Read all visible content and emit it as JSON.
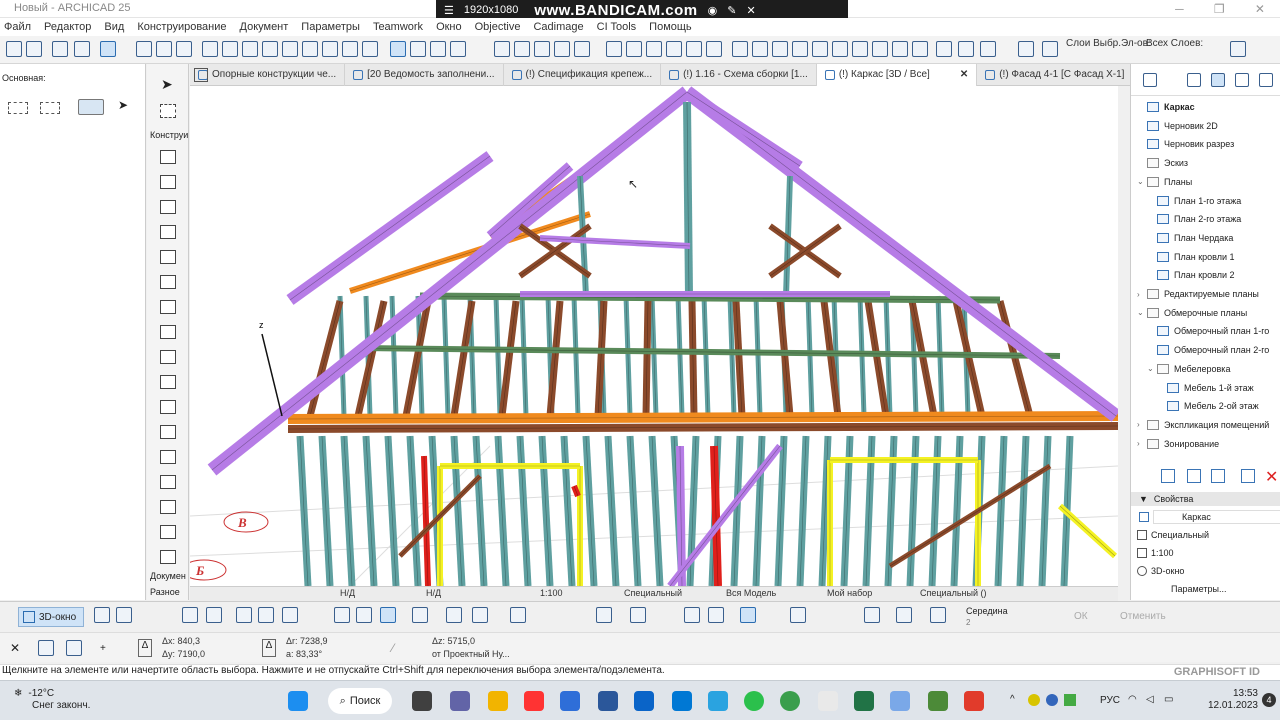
{
  "app": {
    "title": "Новый - ARCHICAD 25"
  },
  "recorder": {
    "resolution": "1920x1080",
    "brand": "www.BANDICAM.com"
  },
  "menu": [
    "Файл",
    "Редактор",
    "Вид",
    "Конструирование",
    "Документ",
    "Параметры",
    "Teamwork",
    "Окно",
    "Objective",
    "Cadimage",
    "CI Tools",
    "Помощь"
  ],
  "toolbar": {
    "layers_label": "Слои Выбр.Эл-ов:",
    "all_layers_label": "Всех Слоев:"
  },
  "leftpanel": {
    "label": "Основная:"
  },
  "toolbox": {
    "select_label": "Конструи",
    "document_label": "Докумен",
    "misc_label": "Разное"
  },
  "tabs": [
    {
      "label": "Опорные конструкции че..."
    },
    {
      "label": "[20 Ведомость заполнени..."
    },
    {
      "label": "(!) Спецификация крепеж..."
    },
    {
      "label": "(!) 1.16 - Схема сборки [1..."
    },
    {
      "label": "(!) Каркас [3D / Все]"
    },
    {
      "label": "(!) Фасад 4-1 [С Фасад Х-1]"
    }
  ],
  "viewport": {
    "axis_z": "z",
    "marker_b": "В",
    "marker_b2": "Б"
  },
  "viewbar": {
    "nd1": "Н/Д",
    "nd2": "Н/Д",
    "scale": "1:100",
    "special": "Специальный",
    "model": "Вся Модель",
    "set": "Мой набор",
    "special2": "Специальный ()"
  },
  "navigator": {
    "items": [
      {
        "label": "Каркас",
        "kind": "view",
        "level": 0,
        "bold": true
      },
      {
        "label": "Черновик 2D",
        "kind": "view",
        "level": 0
      },
      {
        "label": "Черновик разрез",
        "kind": "view",
        "level": 0
      },
      {
        "label": "Эскиз",
        "kind": "folder",
        "level": 0
      },
      {
        "label": "Планы",
        "kind": "folder",
        "level": 0,
        "arrow": "v"
      },
      {
        "label": "План 1-го этажа",
        "kind": "view",
        "level": 1
      },
      {
        "label": "План 2-го этажа",
        "kind": "view",
        "level": 1
      },
      {
        "label": "План Чердака",
        "kind": "view",
        "level": 1
      },
      {
        "label": "План кровли 1",
        "kind": "view",
        "level": 1
      },
      {
        "label": "План кровли 2",
        "kind": "view",
        "level": 1
      },
      {
        "label": "Редактируемые планы",
        "kind": "folder",
        "level": 0,
        "arrow": ">"
      },
      {
        "label": "Обмерочные планы",
        "kind": "folder",
        "level": 0,
        "arrow": "v"
      },
      {
        "label": "Обмерочный план 1-го",
        "kind": "view",
        "level": 1
      },
      {
        "label": "Обмерочный план 2-го",
        "kind": "view",
        "level": 1
      },
      {
        "label": "Мебелеровка",
        "kind": "folder",
        "level": 1,
        "arrow": "v"
      },
      {
        "label": "Мебель 1-й этаж",
        "kind": "view",
        "level": 2
      },
      {
        "label": "Мебель 2-ой этаж",
        "kind": "view",
        "level": 2
      },
      {
        "label": "Экспликация помещений",
        "kind": "folder",
        "level": 0,
        "arrow": ">"
      },
      {
        "label": "Зонирование",
        "kind": "folder",
        "level": 0,
        "arrow": ">"
      }
    ]
  },
  "properties": {
    "header": "Свойства",
    "name_value": "Каркас",
    "layer": "Специальный",
    "scale": "1:100",
    "window": "3D-окно",
    "params_button": "Параметры..."
  },
  "bottombar": {
    "view3d": "3D-окно",
    "snap_label": "Середина",
    "snap_sub": "2",
    "ok": "ОК",
    "cancel": "Отменить"
  },
  "coords": {
    "dx": "Δx: 840,3",
    "dy": "Δy: 7190,0",
    "dr": "Δr: 7238,9",
    "da": "a: 83,33°",
    "dz": "Δz: 5715,0",
    "ref": "от Проектный Ну..."
  },
  "status": {
    "text": "Щелкните на элементе или начертите область выбора. Нажмите и не отпускайте Ctrl+Shift для переключения выбора элемента/подэлемента.",
    "brand": "GRAPHISOFT ID"
  },
  "taskbar": {
    "temp": "-12°C",
    "weather": "Снег законч.",
    "search": "Поиск",
    "lang": "РУС",
    "time": "13:53",
    "date": "12.01.2023",
    "badge": "4"
  },
  "colors": {
    "purple": "#b67ce6",
    "brown": "#8b4a2b",
    "teal": "#5fa0a0",
    "orange": "#f08a1e",
    "yellow": "#f4f224",
    "red": "#e0201b"
  }
}
